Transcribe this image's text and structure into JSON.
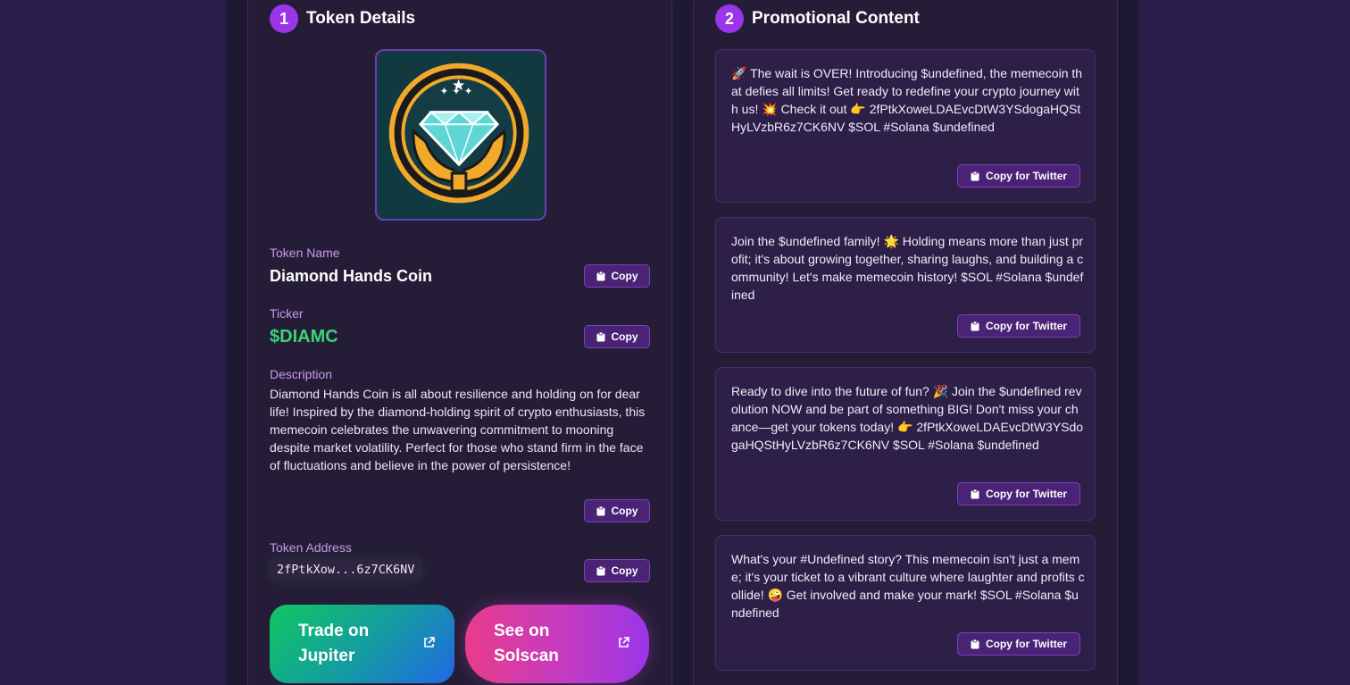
{
  "token_details": {
    "step": "1",
    "title": "Token Details",
    "logo_icon": "diamond-hands-logo",
    "name_label": "Token Name",
    "name": "Diamond Hands Coin",
    "ticker_label": "Ticker",
    "ticker": "$DIAMC",
    "description_label": "Description",
    "description": "Diamond Hands Coin is all about resilience and holding on for dear life! Inspired by the diamond-holding spirit of crypto enthusiasts, this memecoin celebrates the unwavering commitment to mooning despite market volatility. Perfect for those who stand firm in the face of fluctuations and believe in the power of persistence!",
    "address_label": "Token Address",
    "address": "2fPtkXow...6z7CK6NV",
    "copy_label": "Copy",
    "trade_button": "Trade on Jupiter",
    "solscan_button": "See on Solscan"
  },
  "promotional": {
    "step": "2",
    "title": "Promotional Content",
    "copy_label": "Copy for Twitter",
    "posts": [
      {
        "text": "🚀 The wait is OVER! Introducing $undefined, the memecoin that defies all limits! Get ready to redefine your crypto journey with us! 💥 Check it out 👉 2fPtkXoweLDAEvcDtW3YSdogaHQStHyLVzbR6z7CK6NV $SOL #Solana $undefined"
      },
      {
        "text": "Join the $undefined family! 🌟 Holding means more than just profit; it's about growing together, sharing laughs, and building a community! Let's make memecoin history! $SOL #Solana $undefined"
      },
      {
        "text": "Ready to dive into the future of fun? 🎉 Join the $undefined revolution NOW and be part of something BIG! Don't miss your chance—get your tokens today! 👉 2fPtkXoweLDAEvcDtW3YSdogaHQStHyLVzbR6z7CK6NV $SOL #Solana $undefined"
      },
      {
        "text": "What's your #Undefined story? This memecoin isn't just a meme; it's your ticket to a vibrant culture where laughter and profits collide! 🤪 Get involved and make your mark! $SOL #Solana $undefined"
      }
    ]
  },
  "colors": {
    "accent": "#9a35e8",
    "ticker_green": "#39d476",
    "label_purple": "#c79ae8"
  }
}
